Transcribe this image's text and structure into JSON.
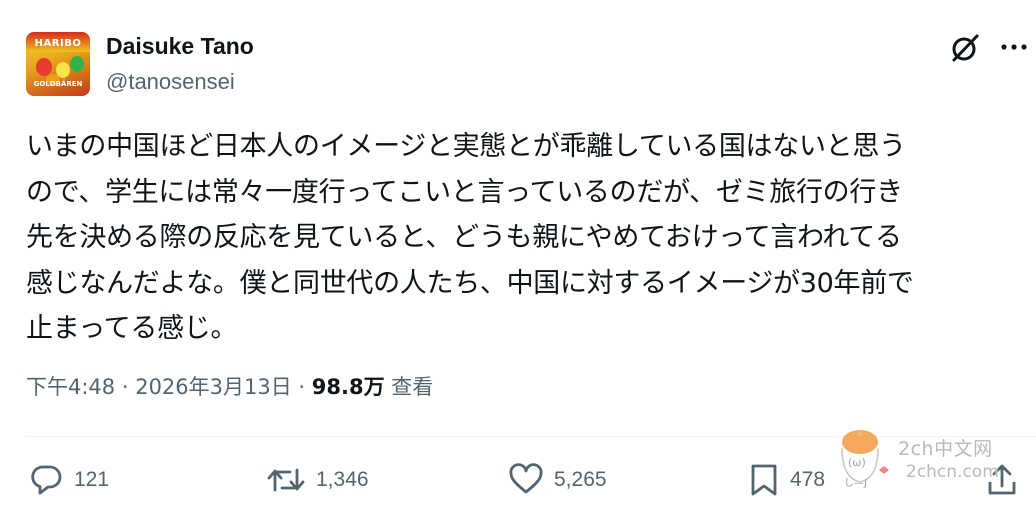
{
  "author": {
    "display_name": "Daisuke Tano",
    "handle": "@tanosensei",
    "avatar_text": "HARIBO",
    "avatar_subtext": "GOLDBÄREN"
  },
  "header_icons": [
    "grok-icon",
    "more-icon"
  ],
  "tweet": {
    "text": "いまの中国ほど日本人のイメージと実態とが乖離している国はないと思う\nので、学生には常々一度行ってこいと言っているのだが、ゼミ旅行の行き\n先を決める際の反応を見ていると、どうも親にやめておけって言われてる\n感じなんだよな。僕と同世代の人たち、中国に対するイメージが30年前で\n止まってる感じ。"
  },
  "meta": {
    "time": "下午4:48",
    "separator1": " · ",
    "date": "2026年3月13日",
    "separator2": " · ",
    "views_count": "98.8万",
    "views_label": " 查看"
  },
  "actions": {
    "reply_count": "121",
    "retweet_count": "1,346",
    "like_count": "5,265",
    "bookmark_count": "478"
  },
  "watermark": {
    "line1": "2ch中文网",
    "line2": "2chcn.com"
  },
  "colors": {
    "text_primary": "#0f1419",
    "text_secondary": "#536471",
    "divider": "#eff3f4",
    "watermark": "#b9b9b9"
  }
}
